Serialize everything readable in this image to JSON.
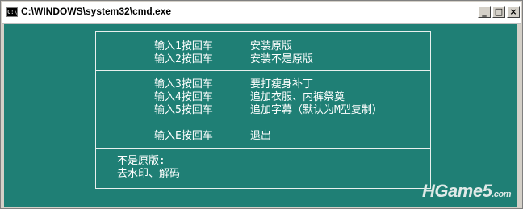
{
  "window": {
    "title": "C:\\WINDOWS\\system32\\cmd.exe",
    "icon": "cmd-icon",
    "icon_text": "C:\\",
    "controls": {
      "minimize": "_",
      "maximize": "□",
      "close": "×"
    }
  },
  "menu": {
    "section1": [
      {
        "key": "输入1按回车",
        "action": "安装原版"
      },
      {
        "key": "输入2按回车",
        "action": "安装不是原版"
      }
    ],
    "section2": [
      {
        "key": "输入3按回车",
        "action": "要打瘦身补丁"
      },
      {
        "key": "输入4按回车",
        "action": "追加衣服、内裤祭奠"
      },
      {
        "key": "输入5按回车",
        "action": "追加字幕（默认为M型复制）"
      }
    ],
    "section3": [
      {
        "key": "输入E按回车",
        "action": "退出"
      }
    ],
    "notes": [
      "不是原版:",
      "去水印、解码"
    ]
  },
  "watermark": {
    "main": "HGame5",
    "domain": ".com"
  },
  "colors": {
    "console_bg": "#1f7f75",
    "text": "#ffffff"
  }
}
